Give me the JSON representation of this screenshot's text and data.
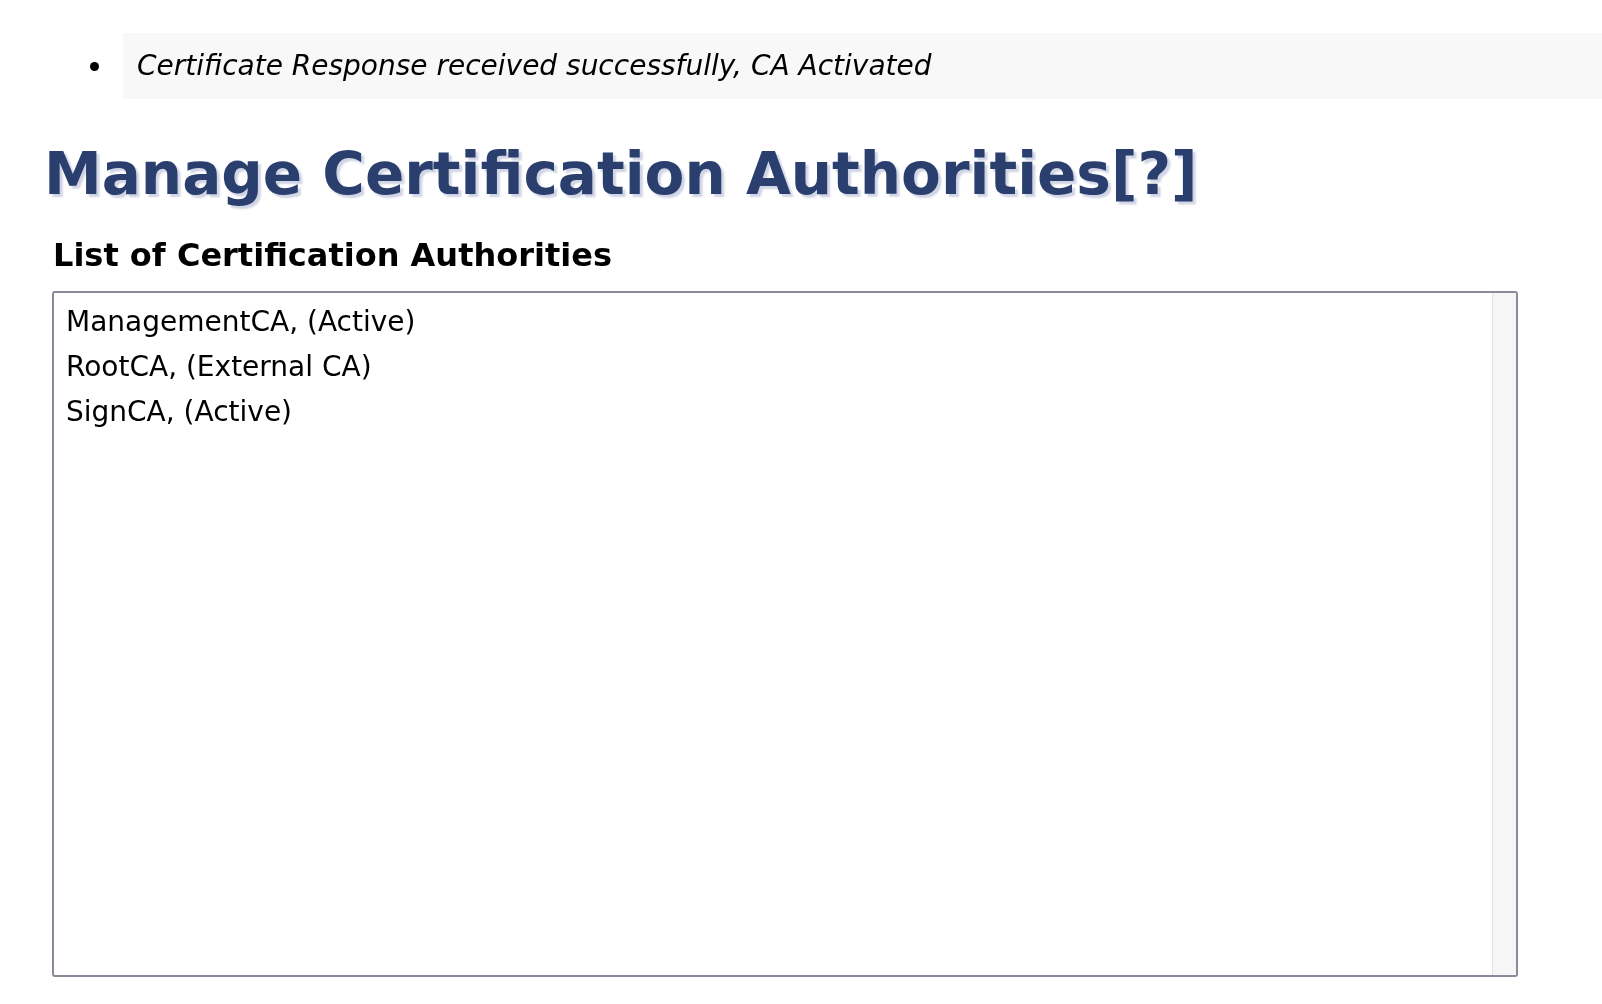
{
  "messages": [
    "Certificate Response received successfully, CA Activated"
  ],
  "heading": {
    "title": "Manage Certification Authorities",
    "help_link": "[?]"
  },
  "list_title": "List of Certification Authorities",
  "ca_list": [
    {
      "label": "ManagementCA, (Active)",
      "selected": false
    },
    {
      "label": "RootCA, (External CA)",
      "selected": false
    },
    {
      "label": "SignCA, (Active)",
      "selected": false
    }
  ]
}
